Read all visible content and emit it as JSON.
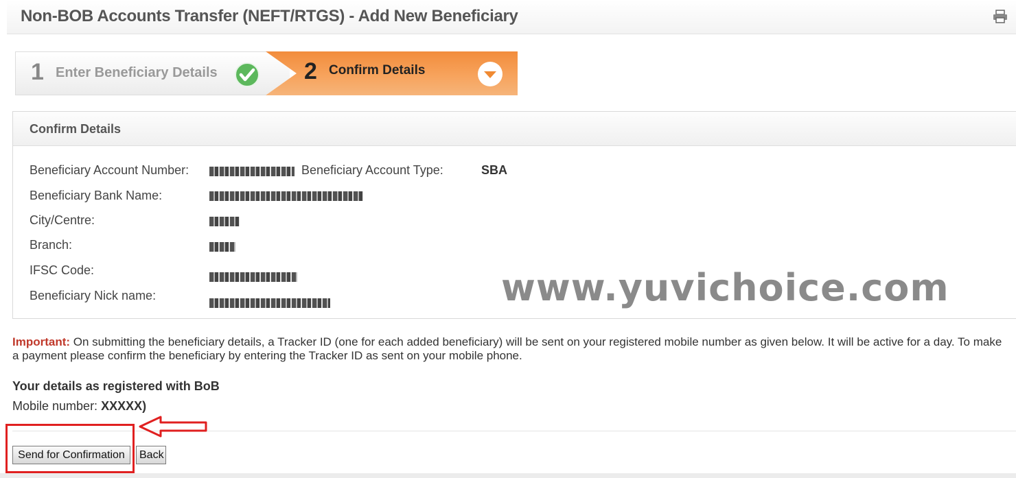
{
  "header": {
    "title": "Non-BOB Accounts Transfer (NEFT/RTGS) - Add New Beneficiary",
    "print_icon": "printer-icon"
  },
  "stepper": {
    "steps": [
      {
        "number": "1",
        "label": "Enter Beneficiary Details",
        "status": "completed",
        "icon": "check-circle-icon"
      },
      {
        "number": "2",
        "label": "Confirm Details",
        "status": "active",
        "icon": "chevron-down-circle-icon"
      }
    ]
  },
  "panel": {
    "title": "Confirm Details",
    "fields": {
      "account_number": {
        "label": "Beneficiary Account Number:",
        "value_masked": true
      },
      "account_type": {
        "label": "Beneficiary Account Type:",
        "value": "SBA"
      },
      "bank_name": {
        "label": "Beneficiary Bank Name:",
        "value_masked": true
      },
      "city": {
        "label": "City/Centre:",
        "value_masked": true
      },
      "branch": {
        "label": "Branch:",
        "value_masked": true
      },
      "ifsc": {
        "label": "IFSC Code:",
        "value_masked": true
      },
      "nick_name": {
        "label": "Beneficiary Nick name:",
        "value_masked": true
      }
    }
  },
  "watermark": "www.yuvichoice.com",
  "notice": {
    "label": "Important:",
    "text": " On submitting the beneficiary details, a Tracker ID (one for each added beneficiary) will be sent on your registered mobile number as given below. It will be active for a day. To make a payment please confirm the beneficiary by entering the Tracker ID as sent on your mobile phone."
  },
  "registered": {
    "heading": "Your details as registered with BoB",
    "mobile_label": "Mobile number: ",
    "mobile_value": "XXXXX)"
  },
  "buttons": {
    "send": "Send for Confirmation",
    "back": "Back"
  },
  "colors": {
    "active_step": "#f7a35c",
    "check_green": "#5cb85c",
    "important_red": "#c0392b",
    "annotation_red": "#e02020"
  }
}
